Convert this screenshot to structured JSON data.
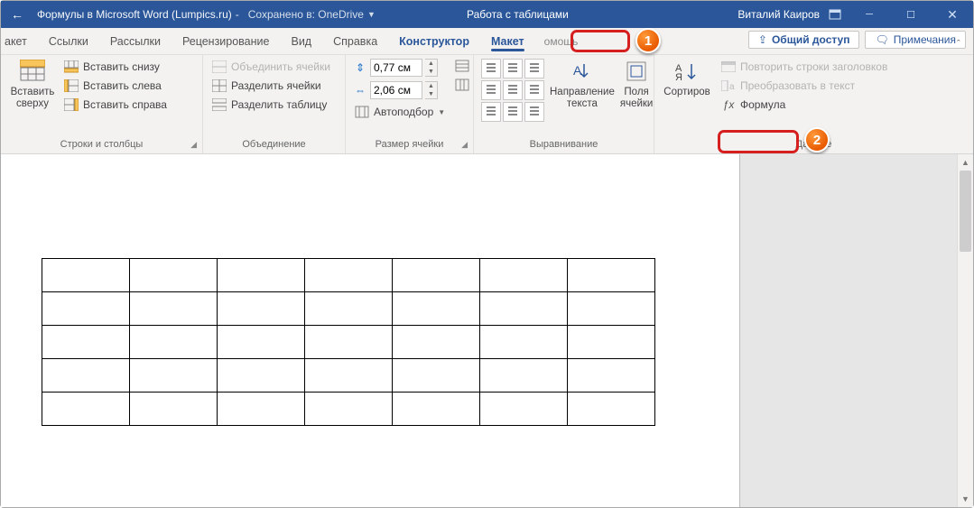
{
  "title": {
    "doc": "Формулы в Microsoft Word (Lumpics.ru)",
    "saved": "Сохранено в: OneDrive",
    "context": "Работа с таблицами",
    "user": "Виталий Каиров"
  },
  "tabs": {
    "cut": "акет",
    "links": "Ссылки",
    "mailings": "Рассылки",
    "review": "Рецензирование",
    "view": "Вид",
    "help": "Справка",
    "design": "Конструктор",
    "layout": "Макет",
    "tell_partial": "омощь",
    "share": "Общий доступ",
    "comments": "Примечания"
  },
  "ribbon": {
    "rows_cols": {
      "insert_above_big": "Вставить сверху",
      "insert_below": "Вставить снизу",
      "insert_left": "Вставить слева",
      "insert_right": "Вставить справа",
      "label": "Строки и столбцы"
    },
    "merge": {
      "merge_cells": "Объединить ячейки",
      "split_cells": "Разделить ячейки",
      "split_table": "Разделить таблицу",
      "label": "Объединение"
    },
    "cell_size": {
      "height": "0,77 см",
      "width": "2,06 см",
      "autofit": "Автоподбор",
      "label": "Размер ячейки"
    },
    "alignment": {
      "text_direction": "Направление текста",
      "cell_margins": "Поля ячейки",
      "label": "Выравнивание"
    },
    "data": {
      "sort": "Сортиров",
      "repeat_header": "Повторить строки заголовков",
      "convert_text": "Преобразовать в текст",
      "formula": "Формула",
      "label": "Данные"
    }
  },
  "annotations": {
    "one": "1",
    "two": "2"
  },
  "icons": {
    "share": "↗",
    "comment": "💬",
    "fx": "ƒx"
  },
  "table": {
    "rows": 5,
    "cols": 7
  }
}
